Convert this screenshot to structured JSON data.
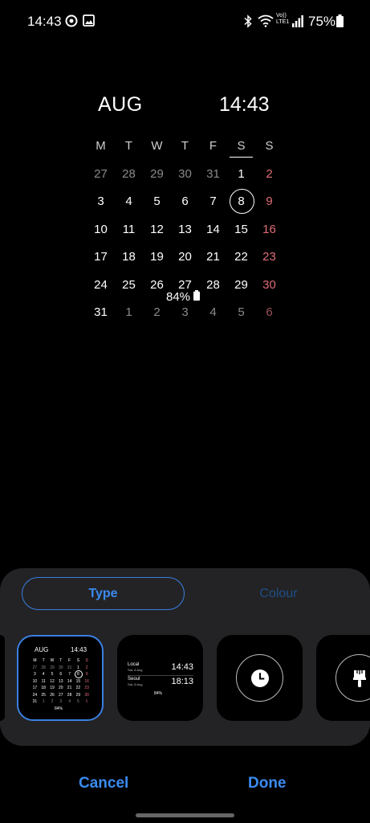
{
  "status_bar": {
    "time": "14:43",
    "network": "LTE1",
    "volte": "Vo))",
    "battery": "75%",
    "icons": [
      "target-icon",
      "gallery-icon",
      "bluetooth-icon",
      "wifi-icon",
      "signal-icon",
      "battery-icon"
    ]
  },
  "widget": {
    "month": "AUG",
    "time": "14:43",
    "weekdays": [
      "M",
      "T",
      "W",
      "T",
      "F",
      "S",
      "S"
    ],
    "weeks": [
      [
        "27",
        "28",
        "29",
        "30",
        "31",
        "1",
        "2"
      ],
      [
        "3",
        "4",
        "5",
        "6",
        "7",
        "8",
        "9"
      ],
      [
        "10",
        "11",
        "12",
        "13",
        "14",
        "15",
        "16"
      ],
      [
        "17",
        "18",
        "19",
        "20",
        "21",
        "22",
        "23"
      ],
      [
        "24",
        "25",
        "26",
        "27",
        "28",
        "29",
        "30"
      ],
      [
        "31",
        "1",
        "2",
        "3",
        "4",
        "5",
        "6"
      ]
    ],
    "today": "8",
    "battery": "84%"
  },
  "panel": {
    "tabs": [
      {
        "label": "Type",
        "selected": true
      },
      {
        "label": "Colour",
        "selected": false
      }
    ],
    "thumbnails": {
      "calendar": {
        "month": "AUG",
        "time": "14:43",
        "battery": "84%"
      },
      "world_clock": {
        "cities": [
          {
            "name": "Local",
            "date": "Sat, 8 Aug",
            "time": "14:43"
          },
          {
            "name": "Seoul",
            "date": "Sat, 8 Aug",
            "time": "18:13"
          }
        ],
        "battery": "84%"
      },
      "clock_icon": "clock-icon",
      "theme_icon": "brush-icon"
    }
  },
  "actions": {
    "cancel": "Cancel",
    "done": "Done"
  },
  "colors": {
    "accent": "#3b8bf0",
    "sunday": "#e06d78",
    "panel": "#232325"
  }
}
